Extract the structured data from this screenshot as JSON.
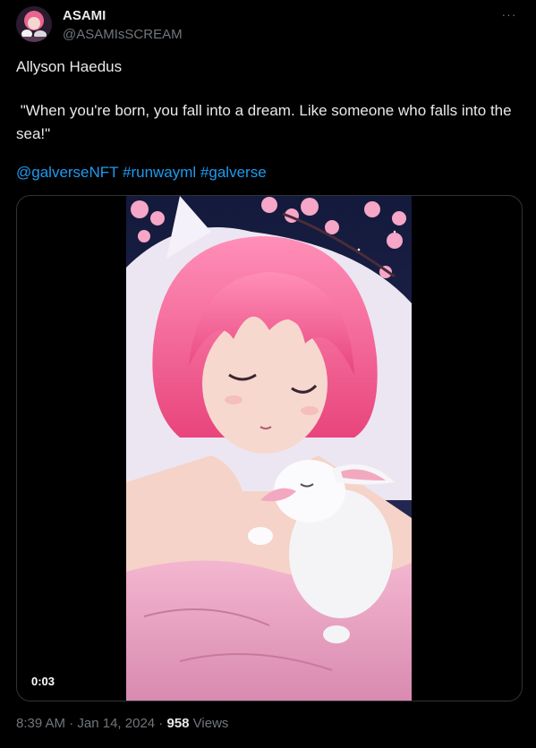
{
  "author": {
    "display_name": "ASAMI",
    "handle": "@ASAMIsSCREAM",
    "avatar_icon": "avatar-image"
  },
  "more_icon": "more-horizontal-icon",
  "more_glyph": "···",
  "tweet": {
    "line1": "Allyson Haedus",
    "line2": "\"When you're born, you fall into a dream. Like someone who falls into the sea!\"",
    "mentions": [
      "@galverseNFT",
      "#runwayml",
      "#galverse"
    ]
  },
  "media": {
    "type": "video",
    "duration": "0:03",
    "description_icon": "anime-video-thumbnail"
  },
  "meta": {
    "time": "8:39 AM",
    "sep1": " · ",
    "date": "Jan 14, 2024",
    "sep2": " · ",
    "views_count": "958",
    "views_label": " Views"
  },
  "colors": {
    "background": "#000000",
    "text": "#e7e9ea",
    "muted": "#71767b",
    "link": "#1d9bf0",
    "border": "#2f3336"
  }
}
